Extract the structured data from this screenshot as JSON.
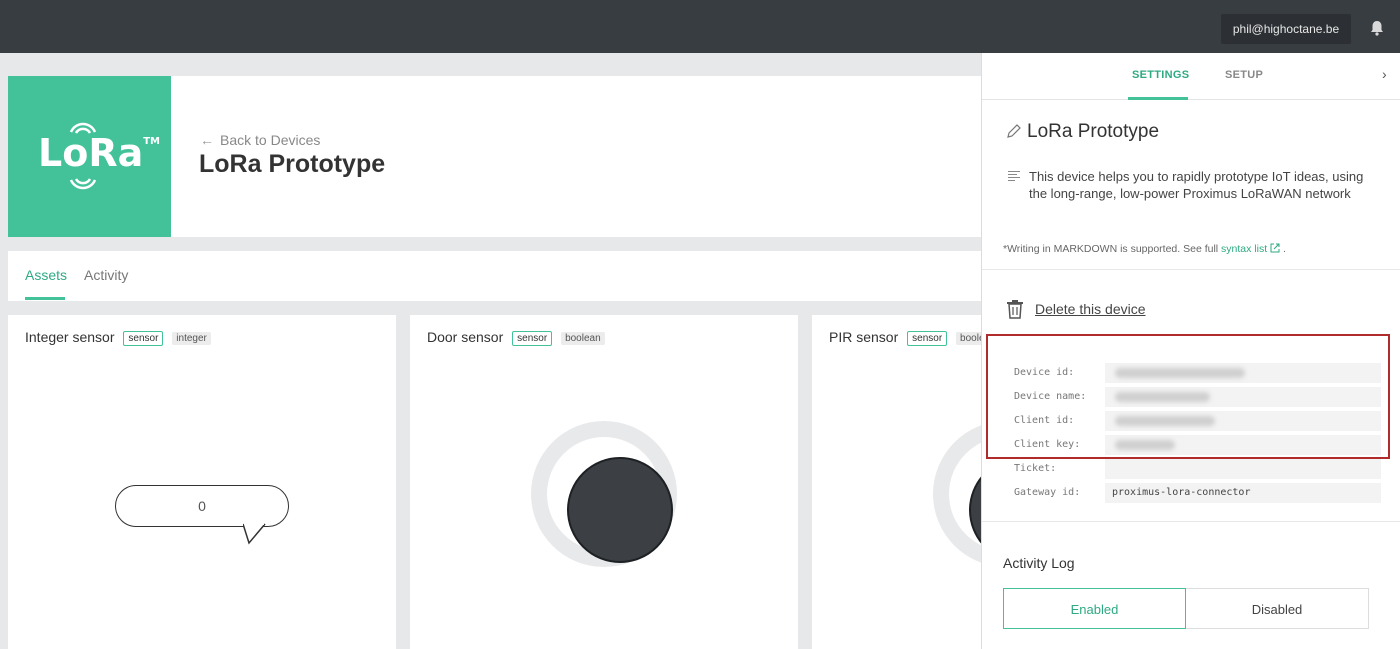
{
  "topbar": {
    "user_email": "phil@highoctane.be"
  },
  "header": {
    "logo_text": "LoRa",
    "logo_tm": "TM",
    "back_label": "Back to Devices",
    "device_title": "LoRa Prototype"
  },
  "tabs": [
    {
      "label": "Assets",
      "active": true
    },
    {
      "label": "Activity",
      "active": false
    }
  ],
  "cards": [
    {
      "title": "Integer sensor",
      "badge1": "sensor",
      "badge2": "integer",
      "value": "0"
    },
    {
      "title": "Door sensor",
      "badge1": "sensor",
      "badge2": "boolean"
    },
    {
      "title": "PIR sensor",
      "badge1": "sensor",
      "badge2": "boolean"
    }
  ],
  "panel": {
    "tabs": [
      {
        "label": "SETTINGS",
        "active": true
      },
      {
        "label": "SETUP",
        "active": false
      }
    ],
    "device_name": "LoRa Prototype",
    "description": "This device helps you to rapidly prototype IoT ideas, using the long-range, low-power Proximus LoRaWAN network",
    "markdown_note_prefix": "*Writing in MARKDOWN is supported. See full ",
    "markdown_link": "syntax list",
    "markdown_note_suffix": " .",
    "delete_label": "Delete this device",
    "credentials": [
      {
        "label": "Device id:",
        "value": ""
      },
      {
        "label": "Device name:",
        "value": ""
      },
      {
        "label": "Client id:",
        "value": ""
      },
      {
        "label": "Client key:",
        "value": ""
      },
      {
        "label": "Ticket:",
        "value": ""
      },
      {
        "label": "Gateway id:",
        "value": "proximus-lora-connector"
      }
    ],
    "activity_log_title": "Activity Log",
    "activity_log_options": [
      "Enabled",
      "Disabled"
    ],
    "activity_log_selected": "Enabled"
  },
  "colors": {
    "accent": "#43c29a",
    "topbar": "#383d42",
    "highlight": "#b02b2b"
  }
}
